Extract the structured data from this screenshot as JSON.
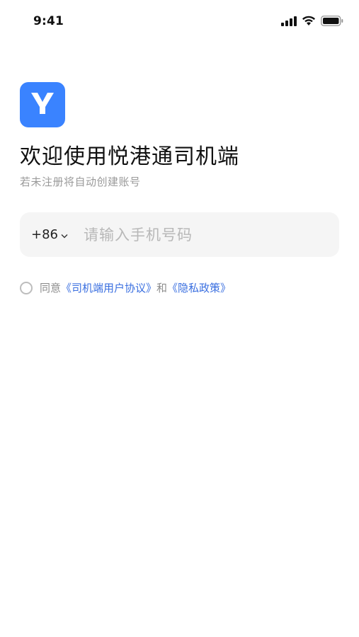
{
  "status_bar": {
    "time": "9:41",
    "icons": [
      "cellular-signal-icon",
      "wifi-icon",
      "battery-icon"
    ]
  },
  "app": {
    "logo_icon": "app-logo-y-icon",
    "brand_color": "#3a83ff"
  },
  "header": {
    "title": "欢迎使用悦港通司机端",
    "subtitle": "若未注册将自动创建账号"
  },
  "login_form": {
    "country_code": "+86",
    "phone_placeholder": "请输入手机号码",
    "phone_value": ""
  },
  "agreement": {
    "prefix": "同意",
    "user_agreement_link": "《司机端用户协议》",
    "conjunction": "和",
    "privacy_policy_link": "《隐私政策》",
    "checked": false,
    "link_color": "#3a6fe0"
  }
}
